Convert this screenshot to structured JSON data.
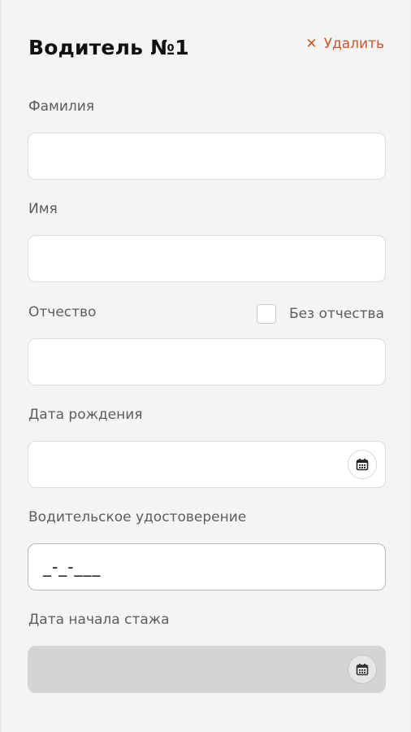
{
  "header": {
    "title": "Водитель №1",
    "delete_label": "Удалить",
    "delete_icon": "close-icon"
  },
  "fields": {
    "last_name": {
      "label": "Фамилия",
      "value": ""
    },
    "first_name": {
      "label": "Имя",
      "value": ""
    },
    "patronymic": {
      "label": "Отчество",
      "value": "",
      "no_patronymic_label": "Без отчества",
      "no_patronymic_checked": false
    },
    "birth_date": {
      "label": "Дата рождения",
      "value": "",
      "icon": "calendar-icon"
    },
    "license": {
      "label": "Водительское удостоверение",
      "mask": "_-_-___"
    },
    "experience_start": {
      "label": "Дата начала стажа",
      "value": "",
      "disabled": true,
      "icon": "calendar-icon"
    }
  },
  "colors": {
    "accent": "#c9592b",
    "background": "#f4f4f4",
    "input_bg": "#ffffff",
    "disabled_bg": "#d4d4d4",
    "label": "#5d5d5d"
  }
}
